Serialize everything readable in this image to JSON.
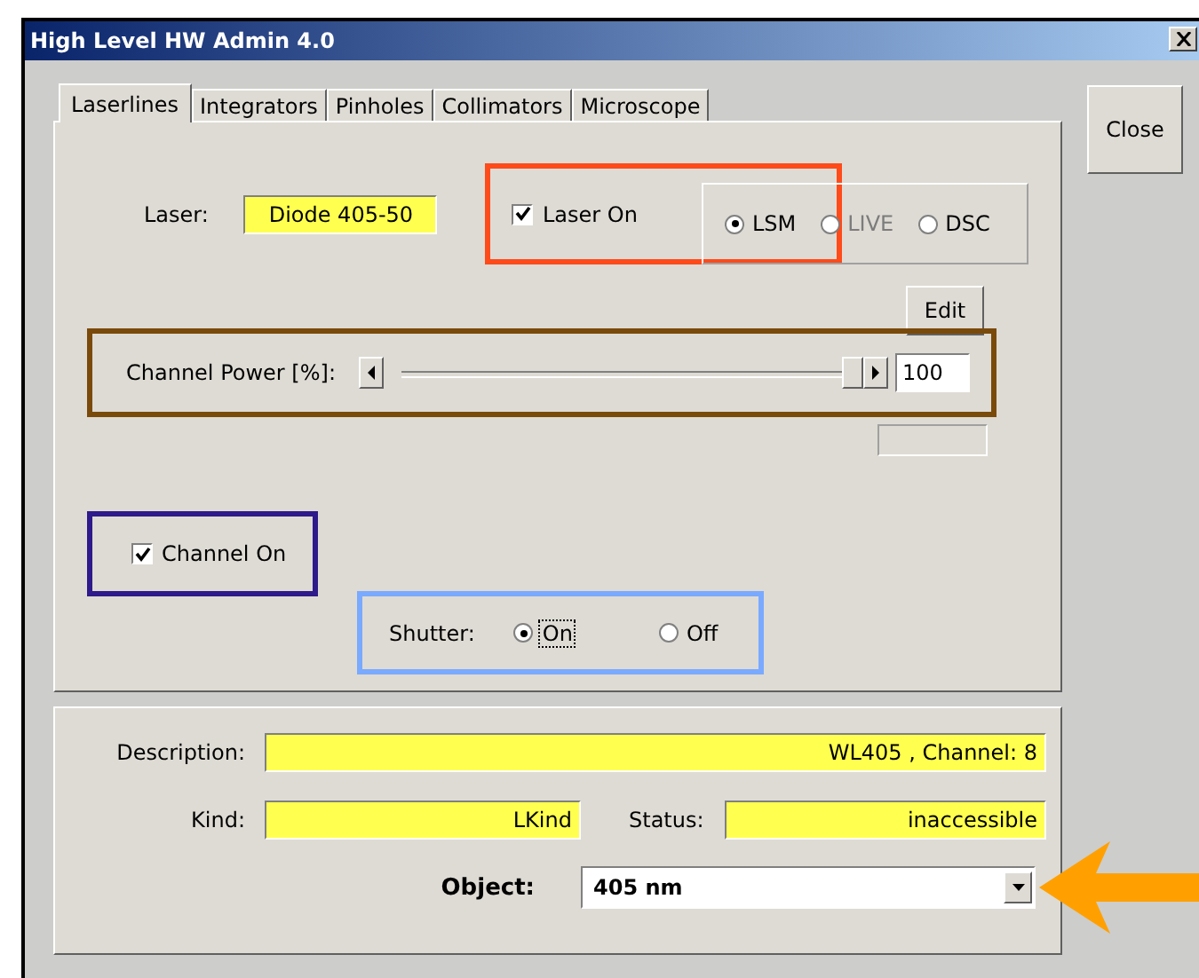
{
  "window": {
    "title": "High Level HW Admin 4.0"
  },
  "tabs": [
    {
      "label": "Laserlines",
      "selected": true
    },
    {
      "label": "Integrators",
      "selected": false
    },
    {
      "label": "Pinholes",
      "selected": false
    },
    {
      "label": "Collimators",
      "selected": false
    },
    {
      "label": "Microscope",
      "selected": false
    }
  ],
  "close_button": "Close",
  "laser": {
    "label": "Laser:",
    "value": "Diode 405-50"
  },
  "laser_on": {
    "label": "Laser On",
    "checked": true
  },
  "mode": [
    {
      "label": "LSM",
      "selected": true,
      "disabled": false
    },
    {
      "label": "LIVE",
      "selected": false,
      "disabled": true
    },
    {
      "label": "DSC",
      "selected": false,
      "disabled": false
    }
  ],
  "edit_button": "Edit",
  "channel_power": {
    "label": "Channel Power [%]:",
    "level": 1.0,
    "value": "100"
  },
  "channel_on": {
    "label": "Channel On",
    "checked": true
  },
  "shutter": {
    "label": "Shutter:",
    "options": [
      {
        "label": "On",
        "selected": true
      },
      {
        "label": "Off",
        "selected": false
      }
    ]
  },
  "description": {
    "label": "Description:",
    "value": "WL405 , Channel: 8"
  },
  "kind": {
    "label": "Kind:",
    "value": "LKind"
  },
  "status": {
    "label": "Status:",
    "value": "inaccessible"
  },
  "object": {
    "label": "Object:",
    "value": "405 nm"
  }
}
